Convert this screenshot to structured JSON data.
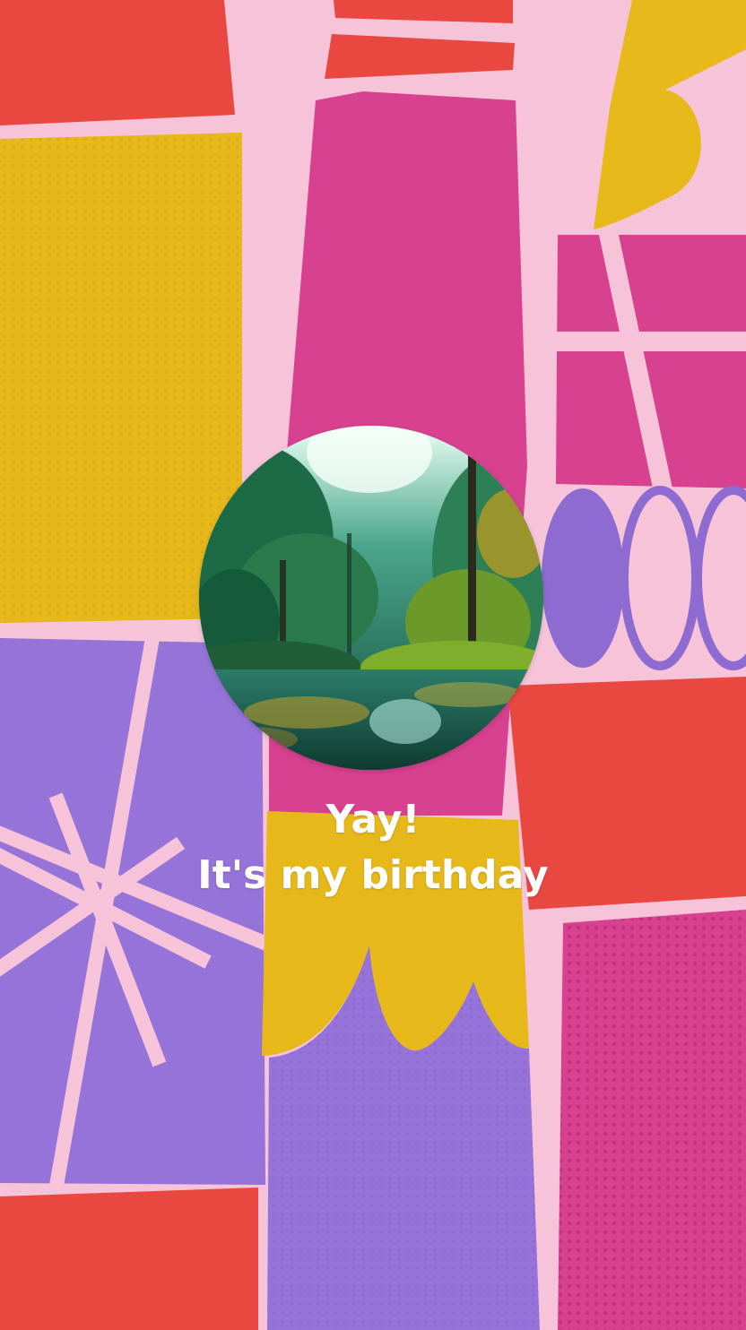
{
  "greeting": {
    "line1": "Yay!",
    "line2": "It's my birthday"
  },
  "colors": {
    "background": "#f6c3d9",
    "red": "#e8483f",
    "yellow": "#e6b81a",
    "magenta": "#d7418f",
    "purple": "#9673d8",
    "text": "#ffffff"
  },
  "photo": {
    "subject": "forest-pond-image"
  }
}
